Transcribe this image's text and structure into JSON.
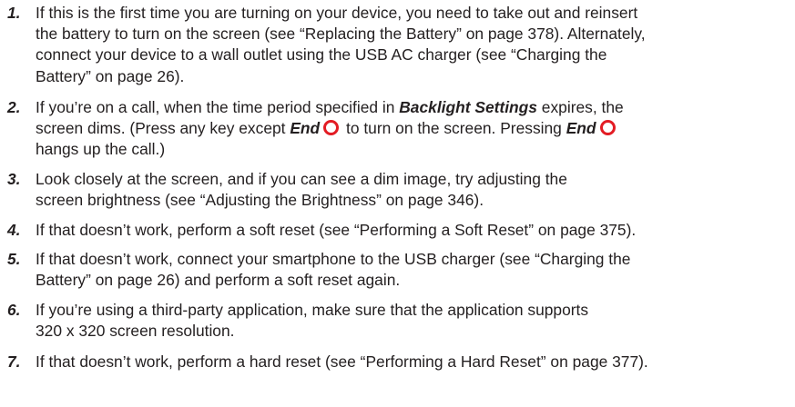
{
  "steps": [
    {
      "number": "1.",
      "lines": [
        "If this is the first time you are turning on your device, you need to take out and reinsert",
        "the battery to turn on the screen (see “Replacing the Battery” on page 378). Alternately,",
        "connect your device to a wall outlet using the USB AC charger (see “Charging the",
        "Battery” on page 26)."
      ]
    },
    {
      "number": "2.",
      "line1_a": "If you’re on a call, when the time period specified in ",
      "line1_em": "Backlight Settings",
      "line1_b": " expires, the",
      "line2_a": "screen dims. (Press any key except ",
      "line2_em1": "End",
      "line2_b": " to turn on the screen. Pressing ",
      "line2_em2": "End",
      "line3": "hangs up the call.)"
    },
    {
      "number": "3.",
      "lines": [
        "Look closely at the screen, and if you can see a dim image, try adjusting the",
        "screen brightness (see “Adjusting the Brightness” on page 346)."
      ]
    },
    {
      "number": "4.",
      "lines": [
        "If that doesn’t work, perform a soft reset (see “Performing a Soft Reset” on page 375)."
      ]
    },
    {
      "number": "5.",
      "lines": [
        "If that doesn’t work, connect your smartphone to the USB charger (see “Charging the",
        "Battery” on page 26) and perform a soft reset again."
      ]
    },
    {
      "number": "6.",
      "lines": [
        "If you’re using a third-party application, make sure that the application supports",
        "320 x 320 screen resolution."
      ]
    },
    {
      "number": "7.",
      "lines": [
        "If that doesn’t work, perform a hard reset (see “Performing a Hard Reset” on page 377)."
      ]
    }
  ],
  "icons": {
    "end_key": "end-key-icon"
  },
  "colors": {
    "text": "#231f20",
    "end_key_ring": "#e31c24"
  }
}
